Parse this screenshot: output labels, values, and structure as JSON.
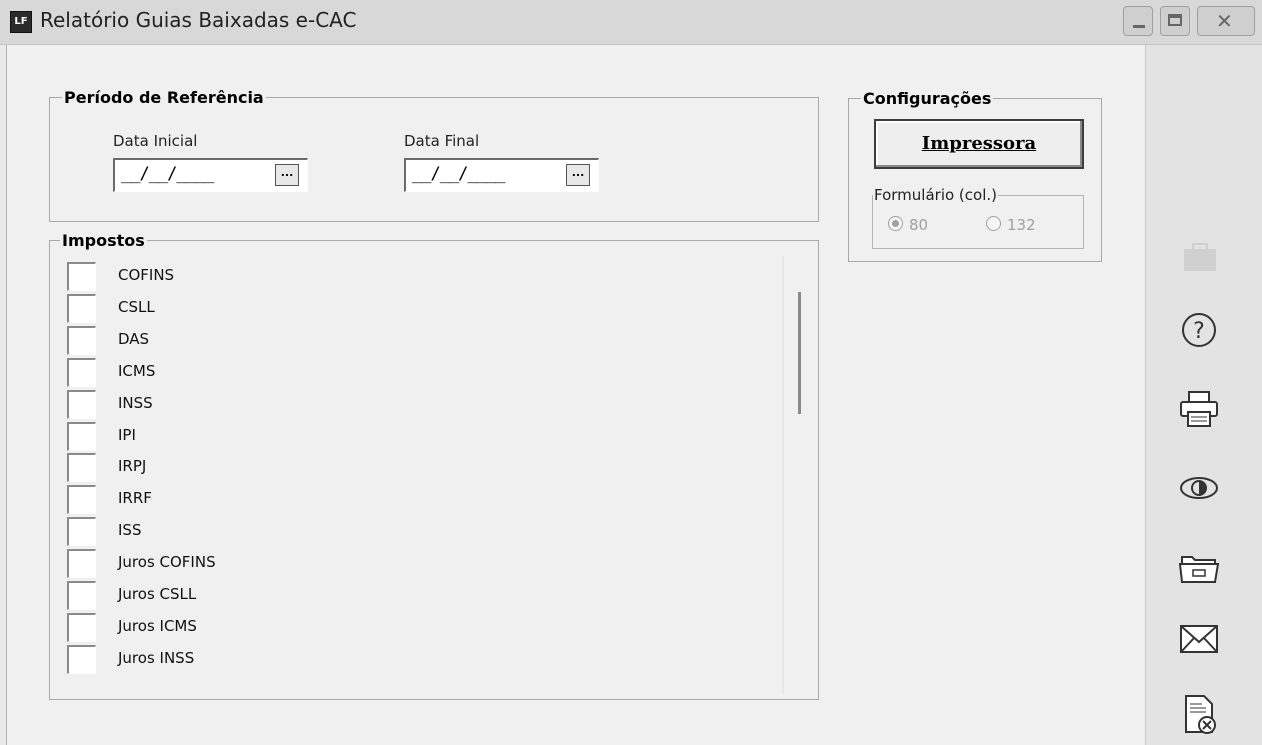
{
  "window": {
    "app_icon_text": "LF",
    "title": "Relatório Guias Baixadas e-CAC"
  },
  "periodo": {
    "legend": "Período de Referência",
    "data_inicial_label": "Data Inicial",
    "data_inicial_value": "__/__/____",
    "data_final_label": "Data Final",
    "data_final_value": "__/__/____",
    "browse_button_label": "..."
  },
  "configuracoes": {
    "legend": "Configurações",
    "impressora_button": "Impressora",
    "formulario_legend": "Formulário (col.)",
    "option_80": "80",
    "option_132": "132",
    "selected": "80"
  },
  "impostos": {
    "legend": "Impostos",
    "items": [
      {
        "label": "COFINS",
        "checked": false
      },
      {
        "label": "CSLL",
        "checked": false
      },
      {
        "label": "DAS",
        "checked": false
      },
      {
        "label": "ICMS",
        "checked": false
      },
      {
        "label": "INSS",
        "checked": false
      },
      {
        "label": "IPI",
        "checked": false
      },
      {
        "label": "IRPJ",
        "checked": false
      },
      {
        "label": "IRRF",
        "checked": false
      },
      {
        "label": "ISS",
        "checked": false
      },
      {
        "label": "Juros COFINS",
        "checked": false
      },
      {
        "label": "Juros CSLL",
        "checked": false
      },
      {
        "label": "Juros ICMS",
        "checked": false
      },
      {
        "label": "Juros INSS",
        "checked": false
      }
    ]
  },
  "toolbar_icons": [
    "briefcase-icon",
    "help-icon",
    "printer-icon",
    "preview-eye-icon",
    "folder-icon",
    "email-icon",
    "document-cancel-icon"
  ]
}
